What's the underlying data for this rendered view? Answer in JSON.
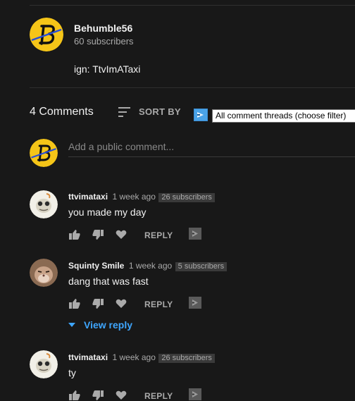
{
  "channel": {
    "name": "Behumble56",
    "subscribers": "60 subscribers",
    "description": "ign: TtvImATaxi"
  },
  "comments_header": {
    "count_label": "4 Comments",
    "sort_label": "SORT BY",
    "filter_value": "All comment threads (choose filter)"
  },
  "composer": {
    "placeholder": "Add a public comment..."
  },
  "comments": [
    {
      "author": "ttvimataxi",
      "time": "1 week ago",
      "badge": "26 subscribers",
      "text": "you made my day",
      "reply_label": "REPLY"
    },
    {
      "author": "Squinty Smile",
      "time": "1 week ago",
      "badge": "5 subscribers",
      "text": "dang that was fast",
      "reply_label": "REPLY",
      "view_reply_label": "View reply"
    },
    {
      "author": "ttvimataxi",
      "time": "1 week ago",
      "badge": "26 subscribers",
      "text": "ty",
      "reply_label": "REPLY"
    }
  ],
  "colors": {
    "background": "#181818",
    "link_blue": "#3ea6ff",
    "logo_yellow": "#f5c518",
    "logo_blue": "#2a4fd6"
  },
  "icons": [
    "behumble-logo",
    "sort-icon",
    "filter-extension-icon",
    "thumbs-up-icon",
    "thumbs-down-icon",
    "heart-icon",
    "creator-extension-icon",
    "chevron-down-icon"
  ]
}
